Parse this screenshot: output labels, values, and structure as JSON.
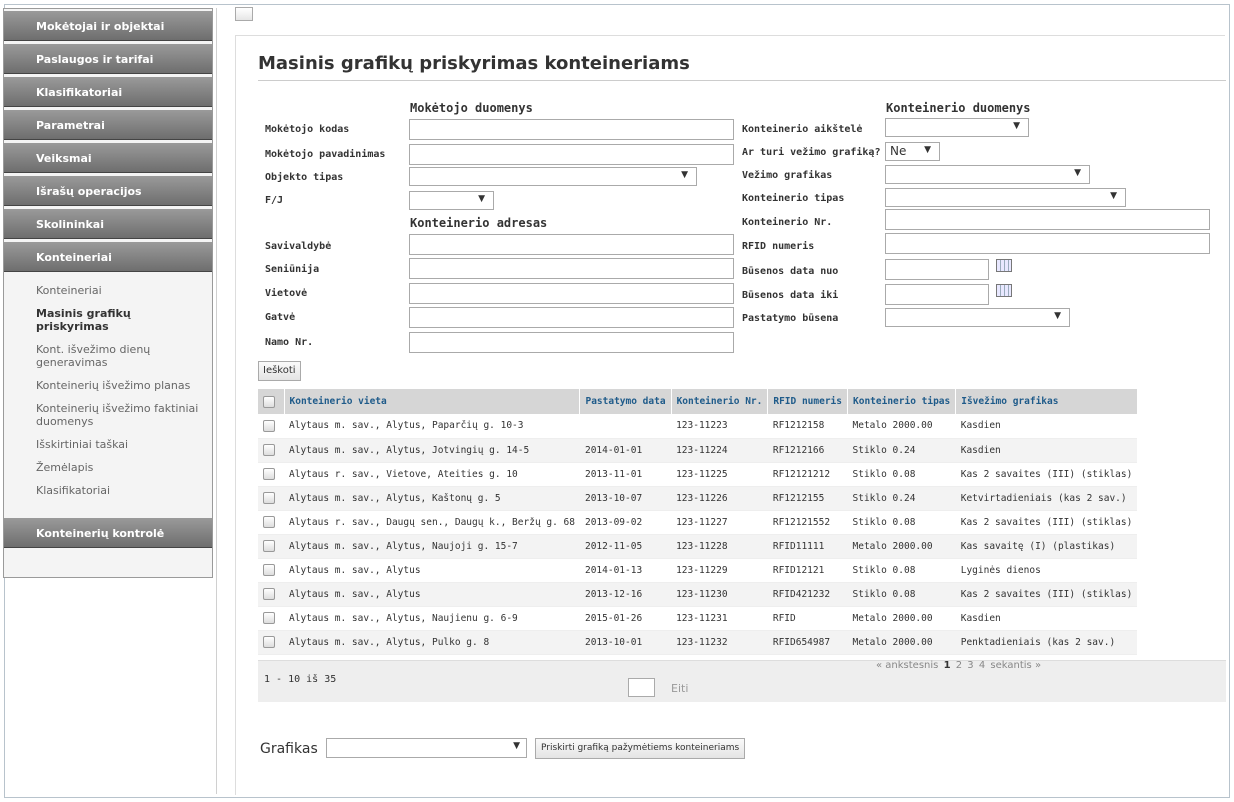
{
  "sidebar": {
    "menu": [
      {
        "label": "Mokėtojai ir objektai"
      },
      {
        "label": "Paslaugos ir tarifai"
      },
      {
        "label": "Klasifikatoriai"
      },
      {
        "label": "Parametrai"
      },
      {
        "label": "Veiksmai"
      },
      {
        "label": "Išrašų operacijos"
      },
      {
        "label": "Skolininkai"
      },
      {
        "label": "Konteineriai"
      }
    ],
    "submenu": [
      {
        "label": "Konteineriai"
      },
      {
        "label": "Masinis grafikų priskyrimas"
      },
      {
        "label": "Kont. išvežimo dienų generavimas"
      },
      {
        "label": "Konteinerių išvežimo planas"
      },
      {
        "label": "Konteinerių išvežimo faktiniai duomenys"
      },
      {
        "label": "Išskirtiniai taškai"
      },
      {
        "label": "Žemėlapis"
      },
      {
        "label": "Klasifikatoriai"
      }
    ],
    "bottom_menu": {
      "label": "Konteinerių kontrolė"
    }
  },
  "page": {
    "title": "Masinis grafikų priskyrimas konteineriams"
  },
  "form": {
    "payer_section": "Mokėtojo duomenys",
    "container_section": "Konteinerio duomenys",
    "address_section": "Konteinerio adresas",
    "labels": {
      "payer_code": "Mokėtojo kodas",
      "payer_name": "Mokėtojo pavadinimas",
      "object_type": "Objekto tipas",
      "fj": "F/J",
      "municipality": "Savivaldybė",
      "eldership": "Seniūnija",
      "locality": "Vietovė",
      "street": "Gatvė",
      "house_no": "Namo Nr.",
      "site": "Konteinerio aikštelė",
      "has_schedule": "Ar turi vežimo grafiką?",
      "schedule": "Vežimo grafikas",
      "container_type": "Konteinerio tipas",
      "container_no": "Konteinerio Nr.",
      "rfid": "RFID numeris",
      "status_from": "Būsenos data nuo",
      "status_to": "Būsenos data iki",
      "placement_status": "Pastatymo būsena"
    },
    "has_schedule_value": "Ne",
    "search_button": "Ieškoti"
  },
  "table": {
    "columns": [
      "Konteinerio vieta",
      "Pastatymo data",
      "Konteinerio Nr.",
      "RFID numeris",
      "Konteinerio tipas",
      "Išvežimo grafikas"
    ],
    "rows": [
      [
        "Alytaus m. sav., Alytus, Paparčių g. 10-3",
        "",
        "123-11223",
        "RF1212158",
        "Metalo 2000.00",
        "Kasdien"
      ],
      [
        "Alytaus m. sav., Alytus, Jotvingių g. 14-5",
        "2014-01-01",
        "123-11224",
        "RF1212166",
        "Stiklo 0.24",
        "Kasdien"
      ],
      [
        "Alytaus r. sav., Vietove, Ateities g. 10",
        "2013-11-01",
        "123-11225",
        "RF12121212",
        "Stiklo 0.08",
        "Kas 2 savaites (III) (stiklas)"
      ],
      [
        "Alytaus m. sav., Alytus, Kaštonų g. 5",
        "2013-10-07",
        "123-11226",
        "RF1212155",
        "Stiklo 0.24",
        "Ketvirtadieniais (kas 2 sav.)"
      ],
      [
        "Alytaus r. sav., Daugų sen., Daugų k., Beržų g. 68",
        "2013-09-02",
        "123-11227",
        "RF12121552",
        "Stiklo 0.08",
        "Kas 2 savaites (III) (stiklas)"
      ],
      [
        "Alytaus m. sav., Alytus, Naujoji g. 15-7",
        "2012-11-05",
        "123-11228",
        "RFID11111",
        "Metalo 2000.00",
        "Kas savaitę (I) (plastikas)"
      ],
      [
        "Alytaus m. sav., Alytus",
        "2014-01-13",
        "123-11229",
        "RFID12121",
        "Stiklo 0.08",
        "Lyginės dienos"
      ],
      [
        "Alytaus m. sav., Alytus",
        "2013-12-16",
        "123-11230",
        "RFID421232",
        "Stiklo 0.08",
        "Kas 2 savaites (III) (stiklas)"
      ],
      [
        "Alytaus m. sav., Alytus, Naujienu g. 6-9",
        "2015-01-26",
        "123-11231",
        "RFID",
        "Metalo 2000.00",
        "Kasdien"
      ],
      [
        "Alytaus m. sav., Alytus, Pulko g. 8",
        "2013-10-01",
        "123-11232",
        "RFID654987",
        "Metalo 2000.00",
        "Penktadieniais (kas 2 sav.)"
      ]
    ]
  },
  "pager": {
    "count": "1 - 10 iš 35",
    "prev": "« ankstesnis",
    "pages": [
      "1",
      "2",
      "3",
      "4"
    ],
    "next": "sekantis »",
    "goto": "Eiti"
  },
  "assign": {
    "label": "Grafikas",
    "button": "Priskirti grafiką pažymėtiems konteineriams"
  },
  "colors": {
    "header_text": "#1f5b8a",
    "nav_bar": "#7a7a7a"
  }
}
